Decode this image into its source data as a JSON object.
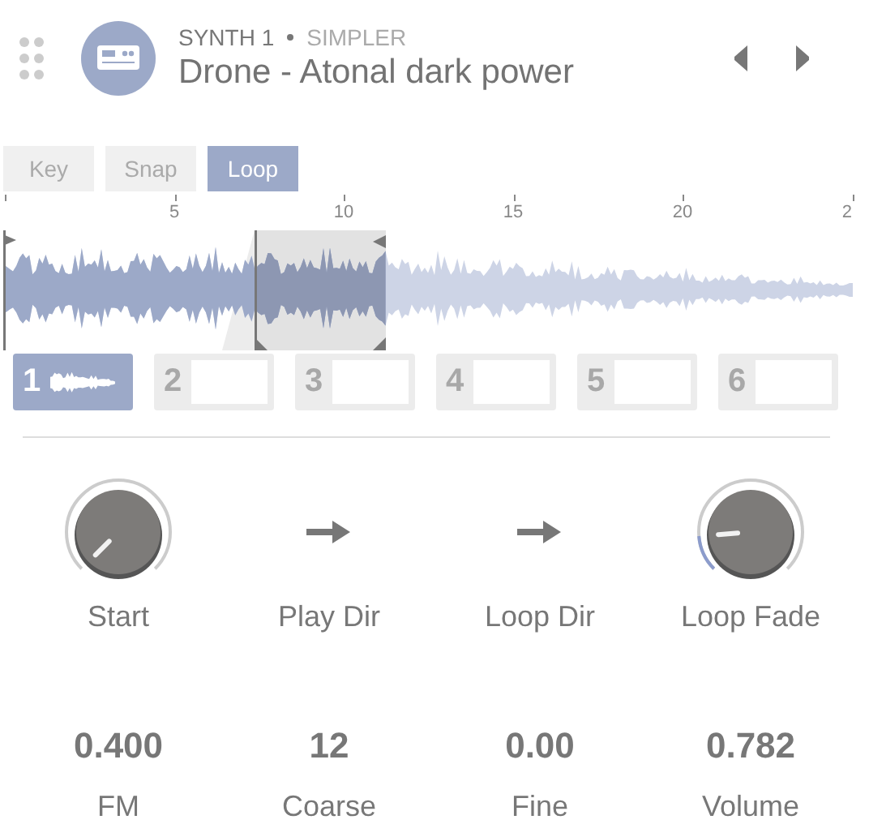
{
  "header": {
    "track": "SYNTH 1",
    "device": "SIMPLER",
    "preset": "Drone - Atonal dark power"
  },
  "modes": [
    {
      "label": "Key",
      "selected": false
    },
    {
      "label": "Snap",
      "selected": false
    },
    {
      "label": "Loop",
      "selected": true
    }
  ],
  "ruler": {
    "labels": [
      "5",
      "10",
      "15",
      "20",
      "2"
    ]
  },
  "slots": [
    {
      "number": "1",
      "selected": true,
      "filled": true
    },
    {
      "number": "2",
      "selected": false,
      "filled": false
    },
    {
      "number": "3",
      "selected": false,
      "filled": false
    },
    {
      "number": "4",
      "selected": false,
      "filled": false
    },
    {
      "number": "5",
      "selected": false,
      "filled": false
    },
    {
      "number": "6",
      "selected": false,
      "filled": false
    }
  ],
  "controls": [
    {
      "kind": "knob",
      "label": "Start"
    },
    {
      "kind": "direction",
      "label": "Play Dir"
    },
    {
      "kind": "direction",
      "label": "Loop Dir"
    },
    {
      "kind": "knob",
      "label": "Loop Fade"
    }
  ],
  "parameters": [
    {
      "value": "0.400",
      "label": "FM"
    },
    {
      "value": "12",
      "label": "Coarse"
    },
    {
      "value": "0.00",
      "label": "Fine"
    },
    {
      "value": "0.782",
      "label": "Volume"
    }
  ]
}
